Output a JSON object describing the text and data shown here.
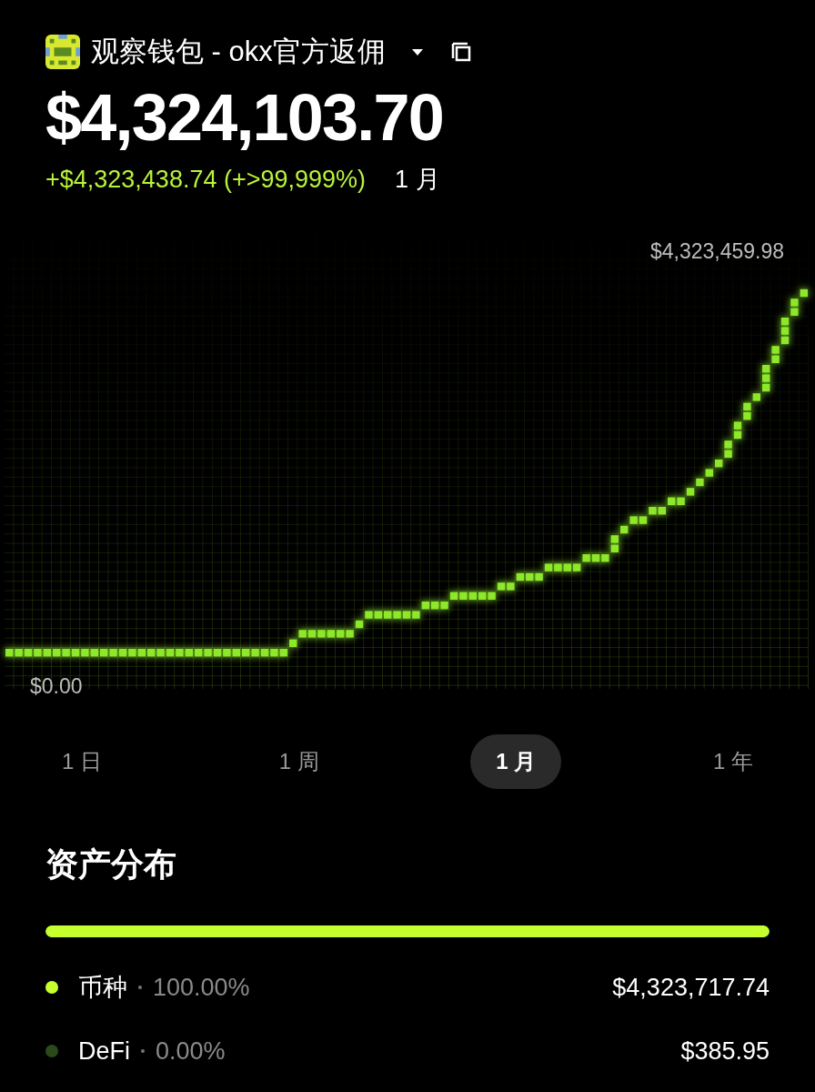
{
  "header": {
    "wallet_name": "观察钱包 - okx官方返佣",
    "total": "$4,324,103.70",
    "change": "+$4,323,438.74 (+>99,999%)",
    "period": "1 月"
  },
  "chart": {
    "max_label": "$4,323,459.98",
    "min_label": "$0.00"
  },
  "periods": [
    {
      "label": "1 日",
      "selected": false
    },
    {
      "label": "1 周",
      "selected": false
    },
    {
      "label": "1 月",
      "selected": true
    },
    {
      "label": "1 年",
      "selected": false
    }
  ],
  "allocation": {
    "title": "资产分布",
    "level": 1,
    "items": [
      {
        "name": "币种",
        "percent": "100.00%",
        "value": "$4,323,717.74",
        "color": "#c6ff2e"
      },
      {
        "name": "DeFi",
        "percent": "0.00%",
        "value": "$385.95",
        "color": "#2a4a1a"
      }
    ]
  }
}
